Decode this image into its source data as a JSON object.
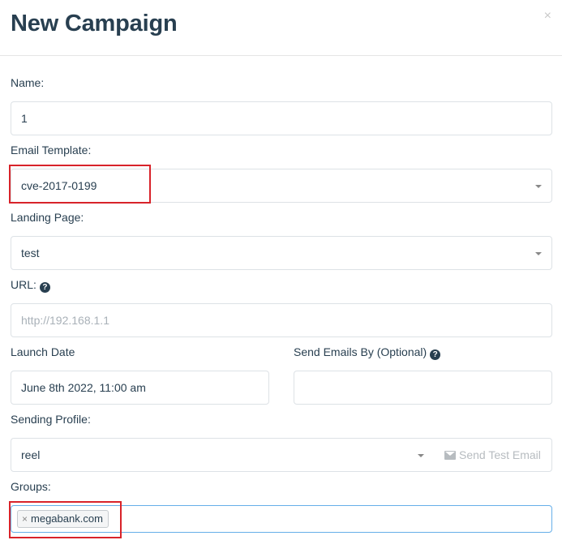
{
  "modal": {
    "title": "New Campaign",
    "close_label": "×"
  },
  "form": {
    "name": {
      "label": "Name:",
      "value": "1"
    },
    "email_template": {
      "label": "Email Template:",
      "value": "cve-2017-0199"
    },
    "landing_page": {
      "label": "Landing Page:",
      "value": "test"
    },
    "url": {
      "label": "URL:",
      "placeholder": "http://192.168.1.1",
      "help_icon": "question-circle-icon"
    },
    "launch_date": {
      "label": "Launch Date",
      "value": "June 8th 2022, 11:00 am"
    },
    "send_emails_by": {
      "label": "Send Emails By (Optional)",
      "value": "",
      "help_icon": "question-circle-icon"
    },
    "sending_profile": {
      "label": "Sending Profile:",
      "value": "reel",
      "send_test_label": "Send Test Email",
      "send_test_icon": "envelope-icon"
    },
    "groups": {
      "label": "Groups:",
      "tags": [
        {
          "remove": "×",
          "label": "megabank.com"
        }
      ]
    }
  },
  "colors": {
    "text": "#283f50",
    "border": "#dde2e6",
    "focus_border": "#66afe9",
    "highlight": "#d8232a",
    "muted": "#b7bcc0"
  }
}
